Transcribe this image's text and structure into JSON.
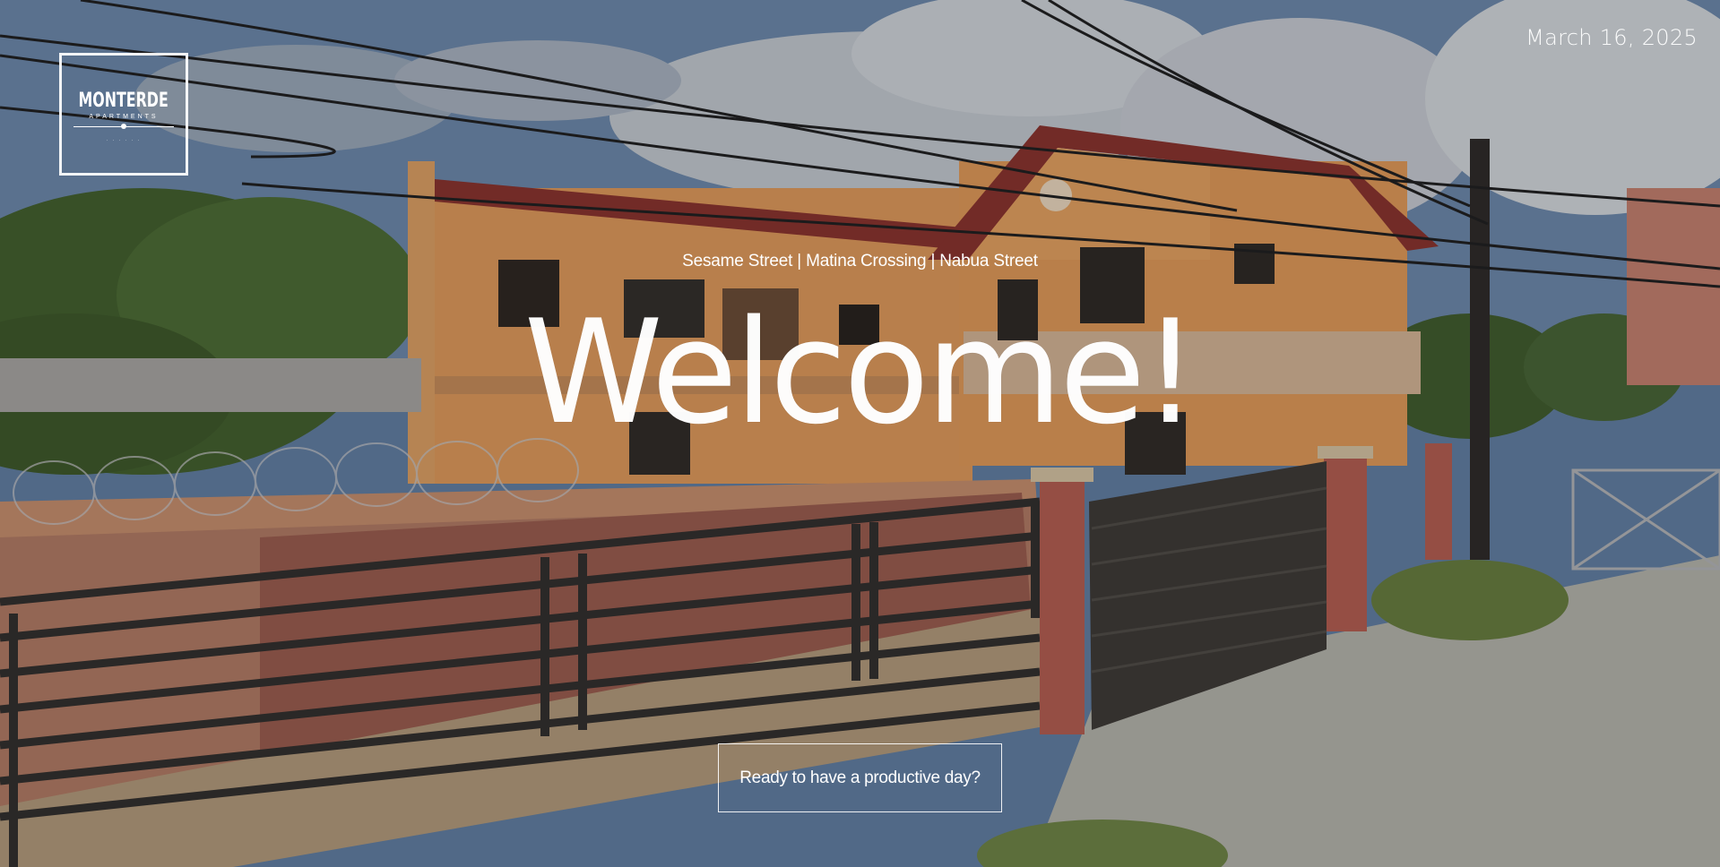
{
  "logo": {
    "name": "MONTERDE",
    "sub": "APARTMENTS",
    "tagline": "· · · · · ·"
  },
  "date": "March 16, 2025",
  "hero": {
    "locations": "Sesame Street | Matina Crossing | Nabua Street",
    "headline": "Welcome!",
    "cta_label": "Ready to have a productive day?"
  },
  "colors": {
    "text": "#ffffff",
    "sky": "#6d87a8",
    "building": "#e59c5c",
    "roof": "#8a2f2a",
    "fence": "#2e2b29"
  },
  "icons": [
    "logo-mark-icon"
  ]
}
